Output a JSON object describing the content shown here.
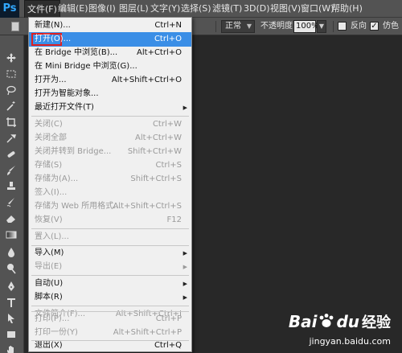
{
  "app": {
    "logo": "Ps"
  },
  "menubar": {
    "items": [
      "文件(F)",
      "编辑(E)",
      "图像(I)",
      "图层(L)",
      "文字(Y)",
      "选择(S)",
      "滤镜(T)",
      "3D(D)",
      "视图(V)",
      "窗口(W)",
      "帮助(H)"
    ],
    "active_index": 0
  },
  "options": {
    "mode": "正常",
    "opacity_label": "不透明度:",
    "opacity_value": "100%",
    "reverse_label": "反向",
    "dither_label": "仿色",
    "dither_checked": true
  },
  "file_menu": {
    "items": [
      {
        "label": "新建(N)...",
        "shortcut": "Ctrl+N",
        "disabled": false
      },
      {
        "label": "打开(O)...",
        "shortcut": "Ctrl+O",
        "disabled": false,
        "highlighted": true
      },
      {
        "label": "在 Bridge 中浏览(B)...",
        "shortcut": "Alt+Ctrl+O",
        "disabled": false
      },
      {
        "label": "在 Mini Bridge 中浏览(G)...",
        "shortcut": "",
        "disabled": false
      },
      {
        "label": "打开为...",
        "shortcut": "Alt+Shift+Ctrl+O",
        "disabled": false
      },
      {
        "label": "打开为智能对象...",
        "shortcut": "",
        "disabled": false
      },
      {
        "label": "最近打开文件(T)",
        "shortcut": "",
        "disabled": false,
        "submenu": true
      },
      {
        "label": "关闭(C)",
        "shortcut": "Ctrl+W",
        "disabled": true
      },
      {
        "label": "关闭全部",
        "shortcut": "Alt+Ctrl+W",
        "disabled": true
      },
      {
        "label": "关闭并转到 Bridge...",
        "shortcut": "Shift+Ctrl+W",
        "disabled": true
      },
      {
        "label": "存储(S)",
        "shortcut": "Ctrl+S",
        "disabled": true
      },
      {
        "label": "存储为(A)...",
        "shortcut": "Shift+Ctrl+S",
        "disabled": true
      },
      {
        "label": "签入(I)...",
        "shortcut": "",
        "disabled": true
      },
      {
        "label": "存储为 Web 所用格式...",
        "shortcut": "Alt+Shift+Ctrl+S",
        "disabled": true
      },
      {
        "label": "恢复(V)",
        "shortcut": "F12",
        "disabled": true
      },
      {
        "label": "置入(L)...",
        "shortcut": "",
        "disabled": true
      },
      {
        "label": "导入(M)",
        "shortcut": "",
        "disabled": false,
        "submenu": true
      },
      {
        "label": "导出(E)",
        "shortcut": "",
        "disabled": true,
        "submenu": true
      },
      {
        "label": "自动(U)",
        "shortcut": "",
        "disabled": false,
        "submenu": true
      },
      {
        "label": "脚本(R)",
        "shortcut": "",
        "disabled": false,
        "submenu": true
      },
      {
        "label": "文件简介(F)...",
        "shortcut": "Alt+Shift+Ctrl+I",
        "disabled": true
      },
      {
        "label": "打印(P)...",
        "shortcut": "Ctrl+P",
        "disabled": true
      },
      {
        "label": "打印一份(Y)",
        "shortcut": "Alt+Shift+Ctrl+P",
        "disabled": true
      },
      {
        "label": "退出(X)",
        "shortcut": "Ctrl+Q",
        "disabled": false
      }
    ]
  },
  "watermark": {
    "brand": "Bai",
    "brand2": "du",
    "cn": "经验",
    "url": "jingyan.baidu.com"
  },
  "colors": {
    "highlight": "#3a8ee6",
    "annotation": "#e02020",
    "menu_bg": "#f0f0f0",
    "chrome": "#535353",
    "canvas": "#282828"
  }
}
